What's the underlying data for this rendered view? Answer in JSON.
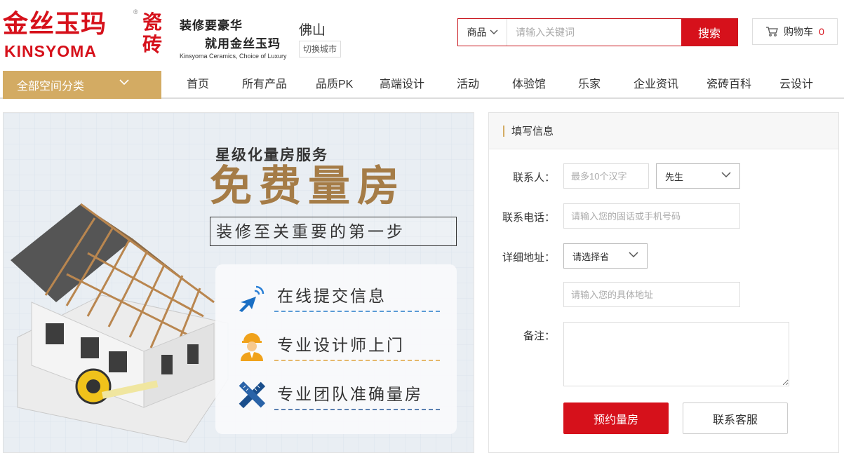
{
  "brand": {
    "name_cn": "金丝玉玛",
    "name_suffix": "瓷砖",
    "name_en": "KINSYOMA",
    "registered": "®",
    "slogan_line1": "装修要豪华",
    "slogan_line2": "就用金丝玉玛",
    "slogan_en": "Kinsyoma Ceramics, Choice of Luxury",
    "brand_color": "#d6111b"
  },
  "city": {
    "name": "佛山",
    "switch_label": "切换城市"
  },
  "search": {
    "category": "商品",
    "placeholder": "请输入关键词",
    "button": "搜索"
  },
  "cart": {
    "label": "购物车",
    "count": "0"
  },
  "nav": {
    "all_categories": "全部空间分类",
    "accent_color": "#d3ab63",
    "items": [
      "首页",
      "所有产品",
      "品质PK",
      "高端设计",
      "活动",
      "体验馆",
      "乐家",
      "企业资讯",
      "瓷砖百科",
      "云设计"
    ]
  },
  "banner": {
    "subtitle": "星级化量房服务",
    "title": "免费量房",
    "tagline": "装修至关重要的第一步",
    "steps": [
      {
        "icon": "cursor-click-icon",
        "text": "在线提交信息"
      },
      {
        "icon": "designer-icon",
        "text": "专业设计师上门"
      },
      {
        "icon": "ruler-tools-icon",
        "text": "专业团队准确量房"
      }
    ]
  },
  "form": {
    "title": "填写信息",
    "contact_label": "联系人：",
    "contact_placeholder": "最多10个汉字",
    "salutation": "先生",
    "phone_label": "联系电话：",
    "phone_placeholder": "请输入您的固话或手机号码",
    "address_label": "详细地址：",
    "province": "请选择省",
    "address_placeholder": "请输入您的具体地址",
    "notes_label": "备注：",
    "submit": "预约量房",
    "service": "联系客服"
  }
}
